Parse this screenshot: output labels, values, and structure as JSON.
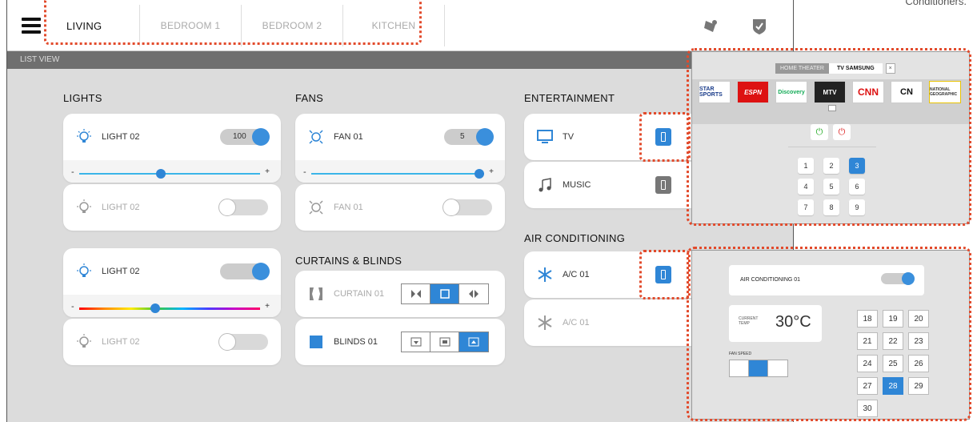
{
  "top_right_caption": "Conditioners.",
  "tabs": [
    "LIVING",
    "BEDROOM 1",
    "BEDROOM 2",
    "KITCHEN"
  ],
  "list_view_label": "LIST VIEW",
  "colors": {
    "accent": "#2f86d6",
    "annotation": "#e24a2b"
  },
  "lights": {
    "heading": "LIGHTS",
    "rows": [
      {
        "label": "LIGHT 02",
        "value": "100",
        "state": "on"
      },
      {
        "label": "LIGHT 02",
        "state": "off"
      },
      {
        "label": "LIGHT 02",
        "state": "on"
      },
      {
        "label": "LIGHT 02",
        "state": "off"
      }
    ],
    "slider_minus": "-",
    "slider_plus": "+",
    "dimmer_level": 0.45,
    "color_level": 0.42
  },
  "fans": {
    "heading": "FANS",
    "rows": [
      {
        "label": "FAN 01",
        "value": "5",
        "state": "on"
      },
      {
        "label": "FAN 01",
        "state": "off"
      }
    ],
    "slider_minus": "-",
    "slider_plus": "+",
    "speed_level": 0.97
  },
  "curtains": {
    "heading": "CURTAINS & BLINDS",
    "rows": [
      {
        "label": "CURTAIN 01",
        "selected": 1
      },
      {
        "label": "BLINDS 01",
        "selected": 2
      }
    ]
  },
  "entertainment": {
    "heading": "ENTERTAINMENT",
    "rows": [
      {
        "label": "TV"
      },
      {
        "label": "MUSIC"
      }
    ]
  },
  "air_conditioning": {
    "heading": "AIR CONDITIONING",
    "rows": [
      {
        "label": "A/C 01"
      },
      {
        "label": "A/C 01"
      }
    ]
  },
  "tv_panel": {
    "tabs": [
      "HOME THEATER",
      "TV SAMSUNG"
    ],
    "close": "×",
    "channels": [
      "STAR SPORTS",
      "ESPN",
      "Discovery",
      "MTV",
      "CNN",
      "CN",
      "NATIONAL GEOGRAPHIC"
    ],
    "keypad": [
      "1",
      "2",
      "3",
      "4",
      "5",
      "6",
      "7",
      "8",
      "9"
    ],
    "selected_key": "3"
  },
  "ac_panel": {
    "title": "AIR CONDITIONING 01",
    "current_temp_label": "CURRENT TEMP",
    "current_temp": "30°C",
    "fan_speed_label": "FAN SPEED",
    "fan_speed_selected": 2,
    "temps": [
      "18",
      "19",
      "20",
      "21",
      "22",
      "23",
      "24",
      "25",
      "26",
      "27",
      "28",
      "29",
      "30"
    ],
    "selected_temp": "28"
  }
}
